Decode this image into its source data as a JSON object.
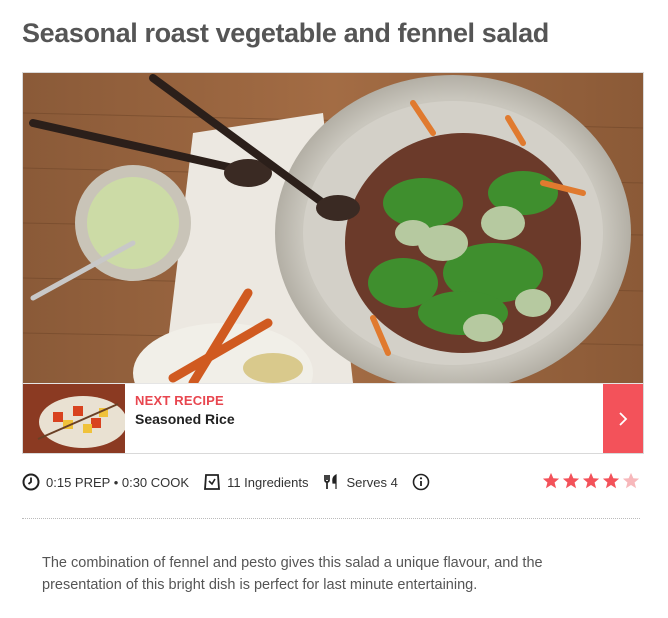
{
  "recipe": {
    "title": "Seasonal roast vegetable and fennel salad",
    "description": "The combination of fennel and pesto gives this salad a unique flavour, and the presentation of this bright dish is perfect for last minute entertaining."
  },
  "next_recipe": {
    "label": "NEXT RECIPE",
    "name": "Seasoned Rice",
    "arrow_icon": "chevron-right-icon"
  },
  "meta": {
    "time_text": "0:15 PREP • 0:30 COOK",
    "ingredients_text": "11 Ingredients",
    "serves_text": "Serves 4",
    "icons": [
      "clock-icon",
      "scale-icon",
      "cutlery-icon",
      "info-icon"
    ]
  },
  "rating": {
    "value": 4,
    "max": 5
  },
  "colors": {
    "accent": "#f3525a",
    "title": "#555555",
    "star_on": "#f3525a",
    "star_off": "#f7b8bb"
  }
}
